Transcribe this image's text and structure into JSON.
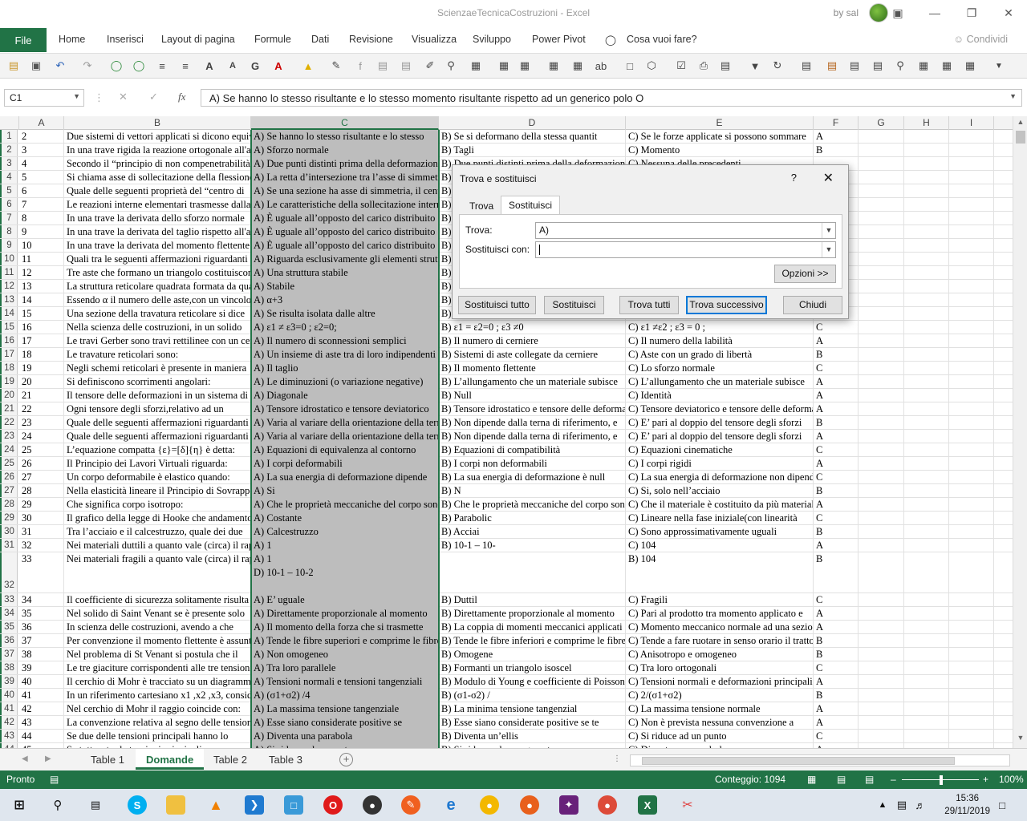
{
  "window": {
    "title": "ScienzaeTecnicaCostruzioni  -  Excel",
    "user": "by sal"
  },
  "ribbon": {
    "file": "File",
    "tabs": [
      "Home",
      "Inserisci",
      "Layout di pagina",
      "Formule",
      "Dati",
      "Revisione",
      "Visualizza",
      "Sviluppo",
      "Power Pivot"
    ],
    "tell_me": "Cosa vuoi fare?",
    "share": "Condividi"
  },
  "formula_bar": {
    "name_box": "C1",
    "fx": "fx",
    "content": "A)  Se hanno lo stesso risultante e lo stesso momento risultante rispetto ad un generico polo O"
  },
  "columns": [
    "A",
    "B",
    "C",
    "D",
    "E",
    "F",
    "G",
    "H",
    "I"
  ],
  "rows": [
    {
      "n": "1",
      "a": "2",
      "b": "Due sistemi di vettori applicati si dicono equivalenti",
      "c": "A)   Se hanno lo stesso risultante e lo stesso",
      "d": "B)   Se si deformano della stessa quantit",
      "e": "C)   Se le forze applicate si possono sommare",
      "f": "A"
    },
    {
      "n": "2",
      "a": "3",
      "b": "In una trave rigida la reazione ortogonale all'asse",
      "c": "A)   Sforzo normale",
      "d": "B)   Tagli",
      "e": "C)   Momento",
      "f": "B"
    },
    {
      "n": "3",
      "a": "4",
      "b": "Secondo il “principio di non compenetrabilità",
      "c": "A)   Due  punti  distinti  prima  della  deformazione",
      "d": "B)   Due  punti  distinti  prima  della  deformazione",
      "e": "C)   Nessuna delle precedenti",
      "f": ""
    },
    {
      "n": "4",
      "a": "5",
      "b": "Si chiama asse di sollecitazione della flessione",
      "c": "A)   La retta d’intersezione tra l’asse di simmetria",
      "d": "B)",
      "e": "",
      "f": ""
    },
    {
      "n": "5",
      "a": "6",
      "b": "Quale delle seguenti proprietà del “centro di",
      "c": "A)   Se una sezione ha asse di simmetria, il centro",
      "d": "B)",
      "e": "",
      "f": ""
    },
    {
      "n": "6",
      "a": "7",
      "b": "Le reazioni interne elementari trasmesse dalla",
      "c": "A)   Le caratteristiche della sollecitazione interna",
      "d": "B)",
      "e": "",
      "f": ""
    },
    {
      "n": "7",
      "a": "8",
      "b": "In una trave la derivata dello sforzo normale",
      "c": "A)   È uguale all’opposto del carico distribuito",
      "d": "B)",
      "e": "",
      "f": ""
    },
    {
      "n": "8",
      "a": "9",
      "b": "In una trave la derivata del taglio rispetto all'asse",
      "c": "A)   È uguale all’opposto del carico distribuito",
      "d": "B)",
      "e": "",
      "f": ""
    },
    {
      "n": "9",
      "a": "10",
      "b": "In una trave la derivata del momento flettente",
      "c": "A)   È uguale all’opposto del carico distribuito",
      "d": "B)",
      "e": "",
      "f": ""
    },
    {
      "n": "10",
      "a": "11",
      "b": "Quali tra le seguenti affermazioni riguardanti",
      "c": "A)   Riguarda esclusivamente gli elementi strutturali",
      "d": "B)",
      "e": "",
      "f": ""
    },
    {
      "n": "11",
      "a": "12",
      "b": "Tre aste che formano un triangolo costituiscono",
      "c": "A)   Una struttura stabile",
      "d": "B)",
      "e": "",
      "f": ""
    },
    {
      "n": "12",
      "a": "13",
      "b": "La struttura reticolare quadrata formata da quattro",
      "c": "A)   Stabile",
      "d": "B)",
      "e": "",
      "f": ""
    },
    {
      "n": "13",
      "a": "14",
      "b": "Essendo α il numero delle aste,con un vincolo",
      "c": "A)   α+3",
      "d": "B)",
      "e": "",
      "f": ""
    },
    {
      "n": "14",
      "a": "15",
      "b": "Una sezione della travatura reticolare si dice",
      "c": "A)   Se  risulta isolata dalle altre",
      "d": "B)",
      "e": "",
      "f": ""
    },
    {
      "n": "15",
      "a": "16",
      "b": "Nella scienza delle costruzioni, in un solido",
      "c": "A)     ε1 ≠ ε3=0 ; ε2=0;",
      "d": "B)   ε1 = ε2=0 ; ε3 ≠0",
      "e": "C)   ε1 ≠ε2 ; ε3 = 0 ;",
      "f": "C"
    },
    {
      "n": "16",
      "a": "17",
      "b": "Le travi Gerber sono travi rettilinee con un certo",
      "c": "A)   Il numero di sconnessioni semplici",
      "d": "B)   Il numero di cerniere",
      "e": "C)   Il numero della labilità",
      "f": "A"
    },
    {
      "n": "17",
      "a": "18",
      "b": "Le travature reticolari sono:",
      "c": "A)   Un insieme di aste tra di loro indipendenti",
      "d": "B)   Sistemi di aste collegate da cerniere",
      "e": "C)   Aste con un grado di libertà",
      "f": "B"
    },
    {
      "n": "18",
      "a": "19",
      "b": "Negli  schemi  reticolari  è  presente  in  maniera",
      "c": "A)   Il taglio",
      "d": "B)   Il momento flettente",
      "e": "C)   Lo sforzo normale",
      "f": "C"
    },
    {
      "n": "19",
      "a": "20",
      "b": "Si definiscono scorrimenti angolari:",
      "c": "A)   Le  diminuzioni  (o  variazione  negative)",
      "d": "B)   L’allungamento che un materiale subisce",
      "e": "C)   L’allungamento che un materiale subisce",
      "f": "A"
    },
    {
      "n": "20",
      "a": "21",
      "b": "Il tensore delle deformazioni in un sistema di",
      "c": "A)   Diagonale",
      "d": "B)   Null",
      "e": "C)   Identità",
      "f": "A"
    },
    {
      "n": "21",
      "a": "22",
      "b": "Ogni  tensore  degli  sforzi,relativo  ad  un",
      "c": "A)   Tensore idrostatico e tensore deviatorico",
      "d": "B)   Tensore idrostatico e tensore delle deformazioni",
      "e": "C)   Tensore deviatorico e tensore delle deformazioni",
      "f": "A"
    },
    {
      "n": "22",
      "a": "23",
      "b": "Quale delle seguenti affermazioni riguardanti",
      "c": "A)   Varia al variare della orientazione della terna",
      "d": "B)   Non dipende dalla terna di riferimento, e",
      "e": "C)   E’ pari al doppio del tensore degli sforzi",
      "f": "B"
    },
    {
      "n": "23",
      "a": "24",
      "b": "Quale delle seguenti affermazioni riguardanti",
      "c": "A)   Varia al variare della orientazione della terna",
      "d": "B)   Non dipende dalla terna di riferimento, e",
      "e": "C)   E’ pari al doppio del tensore degli sforzi",
      "f": "A"
    },
    {
      "n": "24",
      "a": "25",
      "b": "L’equazione compatta {ε}=[δ]{η} è detta:",
      "c": "A)   Equazioni di equivalenza al contorno",
      "d": "B)   Equazioni di compatibilità",
      "e": "C)   Equazioni cinematiche",
      "f": "C"
    },
    {
      "n": "25",
      "a": "26",
      "b": "Il Principio dei Lavori Virtuali riguarda:",
      "c": "A)   I corpi deformabili",
      "d": "B)   I corpi non deformabili",
      "e": "C)   I corpi rigidi",
      "f": "A"
    },
    {
      "n": "26",
      "a": "27",
      "b": "Un corpo deformabile è elastico quando:",
      "c": "A)   La sua energia di deformazione dipende",
      "d": "B)   La sua energia di deformazione è null",
      "e": "C)   La sua energia di deformazione non dipende",
      "f": "C"
    },
    {
      "n": "27",
      "a": "28",
      "b": "Nella elasticità lineare il Principio di Sovrapposizione",
      "c": "A)   Si",
      "d": "B)   N",
      "e": "C)   Si, solo nell’acciaio",
      "f": "B"
    },
    {
      "n": "28",
      "a": "29",
      "b": "Che significa corpo isotropo:",
      "c": "A)   Che le proprietà meccaniche del corpo sono",
      "d": "B)   Che le proprietà meccaniche del corpo sono",
      "e": "C)   Che il materiale è costituito da più materiali",
      "f": "A"
    },
    {
      "n": "29",
      "a": "30",
      "b": "Il grafico della legge di Hooke che andamento",
      "c": "A)   Costante",
      "d": "B)   Parabolic",
      "e": "C)   Lineare  nella  fase  iniziale(con  linearità",
      "f": "C"
    },
    {
      "n": "30",
      "a": "31",
      "b": "Tra l’acciaio e il calcestruzzo, quale dei due",
      "c": "A)   Calcestruzzo",
      "d": "B)   Acciai",
      "e": "C)   Sono approssimativamente uguali",
      "f": "B"
    },
    {
      "n": "31",
      "a": "32",
      "b": "Nei materiali duttili a quanto vale (circa) il rapporto",
      "c": "A)   1",
      "d": "B)   10-1 – 10-",
      "e": "C)   104",
      "f": "A"
    },
    {
      "n": "32",
      "a": "33",
      "b": "Nei materiali fragili a quanto vale (circa) il rapporto",
      "c": "A)   1",
      "c2": "D)   10-1 – 10-2",
      "d": "",
      "e": "B)   104",
      "f": "B",
      "tall": true
    },
    {
      "n": "33",
      "a": "34",
      "b": "Il coefficiente di sicurezza solitamente risulta",
      "c": "A)   E’ uguale",
      "d": "B)   Duttil",
      "e": "C)   Fragili",
      "f": "C"
    },
    {
      "n": "34",
      "a": "35",
      "b": "Nel solido di Saint Venant se è presente solo",
      "c": "A)   Direttamente proporzionale al momento",
      "d": "B)   Direttamente   proporzionale   al   momento",
      "e": "C)   Pari al prodotto tra momento applicato e",
      "f": "A"
    },
    {
      "n": "35",
      "a": "36",
      "b": "In  scienza  delle  costruzioni,  avendo  a  che",
      "c": "A)   Il  momento  della  forza  che  si  trasmette",
      "d": "B)   La coppia di momenti meccanici applicati",
      "e": "C)   Momento meccanico normale ad una sezione",
      "f": "A"
    },
    {
      "n": "36",
      "a": "37",
      "b": "Per convenzione il momento flettente è assunto",
      "c": "A)   Tende le fibre superiori e comprime le fibre",
      "d": "B)   Tende le fibre inferiori e comprime le fibre",
      "e": "C)   Tende a fare ruotare in senso orario il tratto",
      "f": "B"
    },
    {
      "n": "37",
      "a": "38",
      "b": "Nel problema di St Venant si postula che il",
      "c": "A)   Non omogeneo",
      "d": "B)   Omogene",
      "e": "C)   Anisotropo e omogeneo",
      "f": "B"
    },
    {
      "n": "38",
      "a": "39",
      "b": "Le tre giaciture corrispondenti alle tre tensioni",
      "c": "A)   Tra loro parallele",
      "d": "B)   Formanti un triangolo isoscel",
      "e": "C)   Tra loro ortogonali",
      "f": "C"
    },
    {
      "n": "39",
      "a": "40",
      "b": "Il cerchio di Mohr è tracciato su un diagramma",
      "c": "A)   Tensioni normali e tensioni tangenziali",
      "d": "B)   Modulo di Young e coefficiente di Poisson",
      "e": "C)   Tensioni normali e deformazioni principali",
      "f": "A"
    },
    {
      "n": "40",
      "a": "41",
      "b": "In  un  riferimento  cartesiano  x1  ,x2  ,x3,  considerato",
      "c": "A)   (σ1+σ2) /4",
      "d": "B)   (σ1-σ2) /",
      "e": "C)   2/(σ1+σ2)",
      "f": "B"
    },
    {
      "n": "41",
      "a": "42",
      "b": "Nel cerchio di Mohr il raggio coincide con:",
      "c": "A)   La massima tensione tangenziale",
      "d": "B)   La minima tensione tangenzial",
      "e": "C)   La massima tensione normale",
      "f": "A"
    },
    {
      "n": "42",
      "a": "43",
      "b": "La convenzione relativa al segno delle tensioni",
      "c": "A)   Esse  siano  considerate  positive  se",
      "d": "B)   Esse  siano  considerate  positive  se  te",
      "e": "C)   Non è prevista nessuna convenzione a",
      "f": "A"
    },
    {
      "n": "43",
      "a": "44",
      "b": "Se  due  delle  tensioni  principali  hanno  lo",
      "c": "A)   Diventa una parabola",
      "d": "B)   Diventa un’ellis",
      "e": "C)   Si  riduce ad un punto",
      "f": "C"
    },
    {
      "n": "44",
      "a": "45",
      "b": "Se tutte e tre le tensioni principali sono",
      "c": "A)   Si riduce ad un punto",
      "d": "B)   Si riduce ad un segmento",
      "e": "C)   Diventa una parabola",
      "f": "A"
    }
  ],
  "dialog": {
    "title": "Trova e sostituisci",
    "help": "?",
    "tabs": [
      "Trova",
      "Sostituisci"
    ],
    "find_label": "Trova:",
    "find_value": "A)",
    "replace_label": "Sostituisci con:",
    "replace_value": "",
    "options_button": "Opzioni >>",
    "buttons": {
      "replace_all": "Sostituisci tutto",
      "replace": "Sostituisci",
      "find_all": "Trova tutti",
      "find_next": "Trova successivo",
      "close": "Chiudi"
    }
  },
  "sheets": [
    "Table 1",
    "Domande",
    "Table 2",
    "Table 3"
  ],
  "active_sheet": "Domande",
  "status": {
    "ready": "Pronto",
    "count": "Conteggio: 1094",
    "zoom": "100%"
  },
  "taskbar": {
    "time": "15:36",
    "date": "29/11/2019"
  },
  "colors": {
    "accent": "#217346",
    "selection": "#bdbdbd"
  }
}
